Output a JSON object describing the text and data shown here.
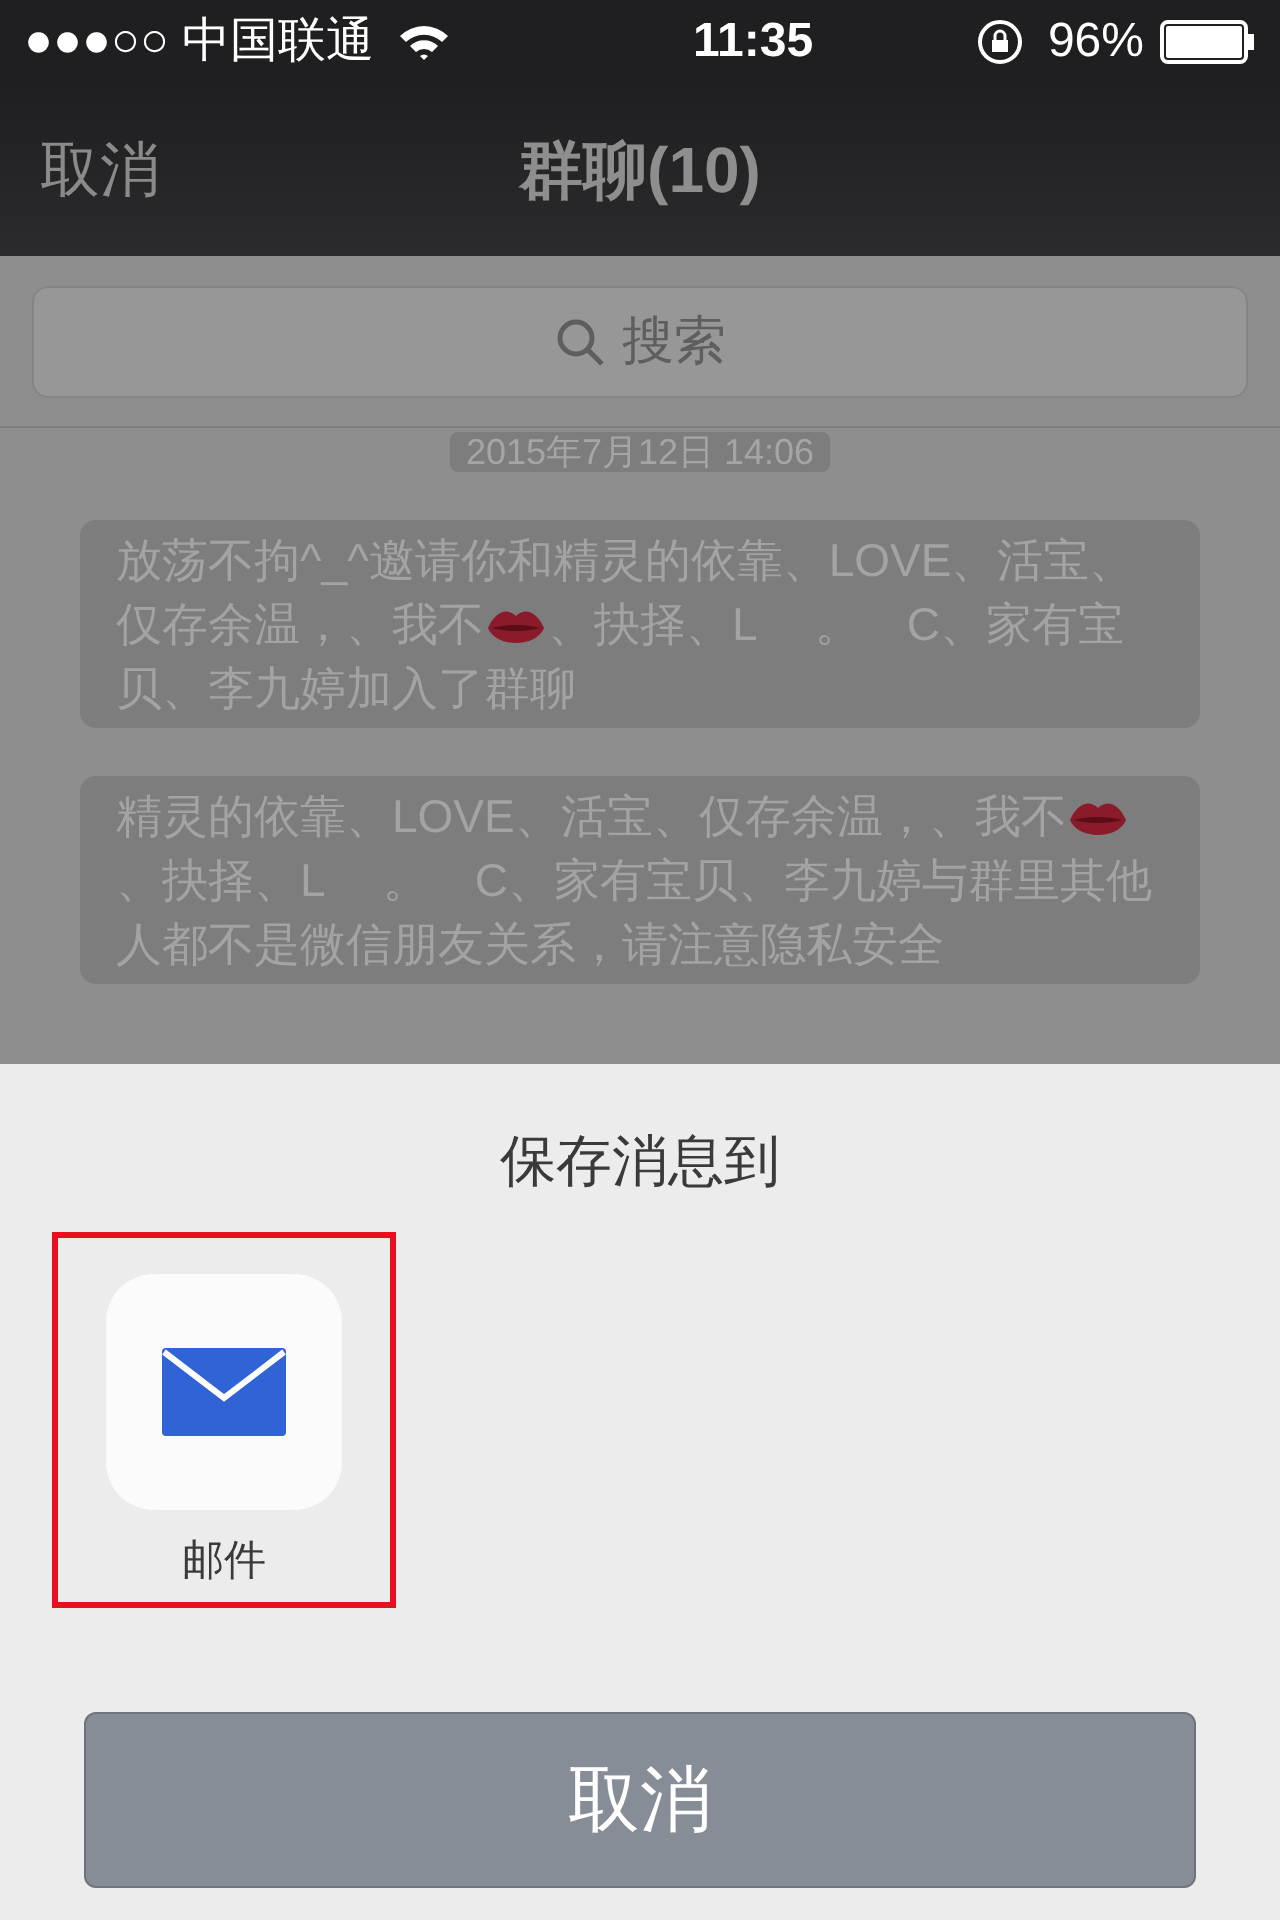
{
  "status_bar": {
    "carrier": "●●●○○ 中国联通",
    "time": "11:35",
    "battery": "96%"
  },
  "nav": {
    "left": "取消",
    "title": "群聊(10)"
  },
  "search": {
    "placeholder": "搜索"
  },
  "timestamp": "2015年7月12日 14:06",
  "messages": [
    {
      "segments": [
        {
          "kind": "text",
          "text": "放荡不拘^_^邀请你和精灵的依靠、LOVE、活宝、仅存余温，、我不"
        },
        {
          "kind": "lips"
        },
        {
          "kind": "text",
          "text": "、抉择、L　 。　C、家有宝贝、李九婷加入了群聊"
        }
      ]
    },
    {
      "segments": [
        {
          "kind": "text",
          "text": "精灵的依靠、LOVE、活宝、仅存余温，、我不"
        },
        {
          "kind": "lips"
        },
        {
          "kind": "text",
          "text": "、抉择、L　 。　C、家有宝贝、李九婷与群里其他人都不是微信朋友关系，请注意隐私安全"
        }
      ]
    }
  ],
  "sheet": {
    "title": "保存消息到",
    "targets": [
      {
        "label": "邮件",
        "highlighted": true
      }
    ],
    "cancel": "取消"
  }
}
